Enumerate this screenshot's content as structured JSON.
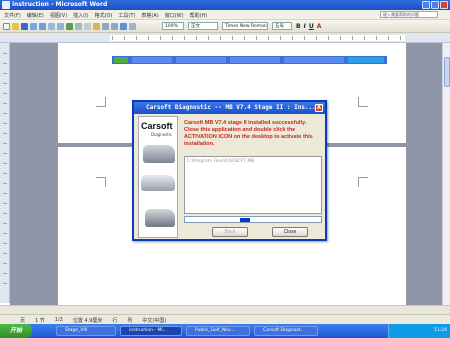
{
  "window": {
    "title": "instruction - Microsoft Word"
  },
  "menubar": {
    "items": [
      "文件(F)",
      "编辑(E)",
      "视图(V)",
      "插入(I)",
      "格式(O)",
      "工具(T)",
      "表格(A)",
      "窗口(W)",
      "帮助(H)"
    ],
    "help_placeholder": "键入需要帮助的问题"
  },
  "toolbar": {
    "zoom": "100%",
    "style": "正文",
    "font": "Times New Roman",
    "size": "五号",
    "bold_label": "B",
    "italic_label": "I",
    "underline_label": "U",
    "font_color_label": "A"
  },
  "dialog": {
    "title": "Carsoft Diagnostic -- MB V7.4 Stage II : Ins...",
    "close_label": "X",
    "brand": "Carsoft",
    "brand_sub": "Diagnostic",
    "message": "Carsoft MB V7.4 stage II installed successfully. Close this application and double click the ACTIVATION ICON on the desktop to activate this installation.",
    "path": "C:\\Program Files\\CARSOFT MB",
    "progress_percent": 45,
    "back_label": "Back",
    "close_button_label": "Close"
  },
  "statusbar": {
    "page": "页",
    "section": "1 节",
    "position": "1/2",
    "location": "位置 4.9厘米",
    "line": "行",
    "column": "列",
    "lang": "中文(中国)"
  },
  "taskbar": {
    "start_label": "开始",
    "tasks": [
      "Stage_VIII",
      "instruction - Mi...",
      "Public_Golf_Nev...",
      "Carsoft Diagnost..."
    ],
    "clock": "11:24"
  },
  "colors": {
    "xp_blue": "#1b4fc4",
    "dialog_text_red": "#c8281e",
    "start_green": "#2f8f2a"
  }
}
